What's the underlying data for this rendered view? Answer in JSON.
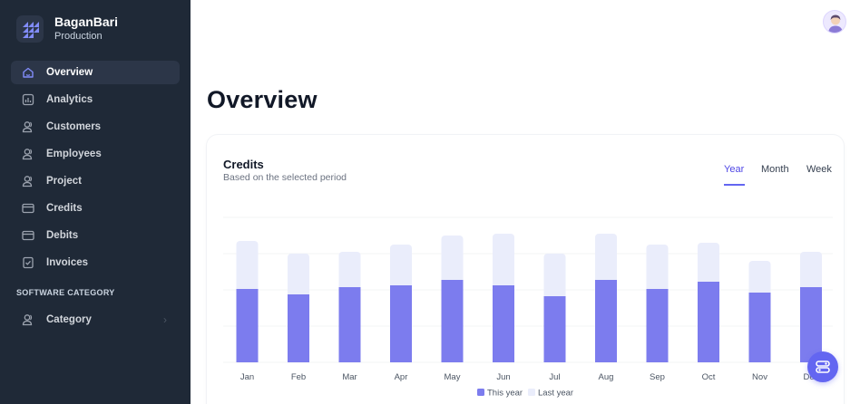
{
  "brand": {
    "name": "BaganBari",
    "subtitle": "Production"
  },
  "sidebar": {
    "items": [
      {
        "label": "Overview",
        "icon": "home-icon",
        "active": true
      },
      {
        "label": "Analytics",
        "icon": "bar-chart-icon"
      },
      {
        "label": "Customers",
        "icon": "user-icon"
      },
      {
        "label": "Employees",
        "icon": "user-icon"
      },
      {
        "label": "Project",
        "icon": "user-icon"
      },
      {
        "label": "Credits",
        "icon": "credit-card-icon"
      },
      {
        "label": "Debits",
        "icon": "credit-card-icon"
      },
      {
        "label": "Invoices",
        "icon": "invoice-icon"
      }
    ],
    "section_title": "SOFTWARE CATEGORY",
    "section_items": [
      {
        "label": "Category",
        "icon": "user-icon",
        "has_chevron": true
      }
    ]
  },
  "page": {
    "title": "Overview"
  },
  "card": {
    "title": "Credits",
    "subtitle": "Based on the selected period",
    "tabs": [
      "Year",
      "Month",
      "Week"
    ],
    "active_tab": "Year"
  },
  "colors": {
    "accent": "#6366f1",
    "this_year": "#7c7cee",
    "last_year": "#eaedfb",
    "sidebar_bg": "#1f2937"
  },
  "chart_data": {
    "type": "bar",
    "stacked": true,
    "categories": [
      "Jan",
      "Feb",
      "Mar",
      "Apr",
      "May",
      "Jun",
      "Jul",
      "Aug",
      "Sep",
      "Oct",
      "Nov",
      "Dec"
    ],
    "series": [
      {
        "name": "This year",
        "values": [
          81,
          75,
          83,
          85,
          91,
          85,
          73,
          91,
          81,
          89,
          77,
          83
        ]
      },
      {
        "name": "Last year",
        "values": [
          53,
          45,
          39,
          45,
          49,
          57,
          47,
          51,
          49,
          43,
          35,
          39
        ]
      }
    ],
    "ylim": [
      0,
      175
    ],
    "grid": true,
    "legend": "bottom-center"
  }
}
